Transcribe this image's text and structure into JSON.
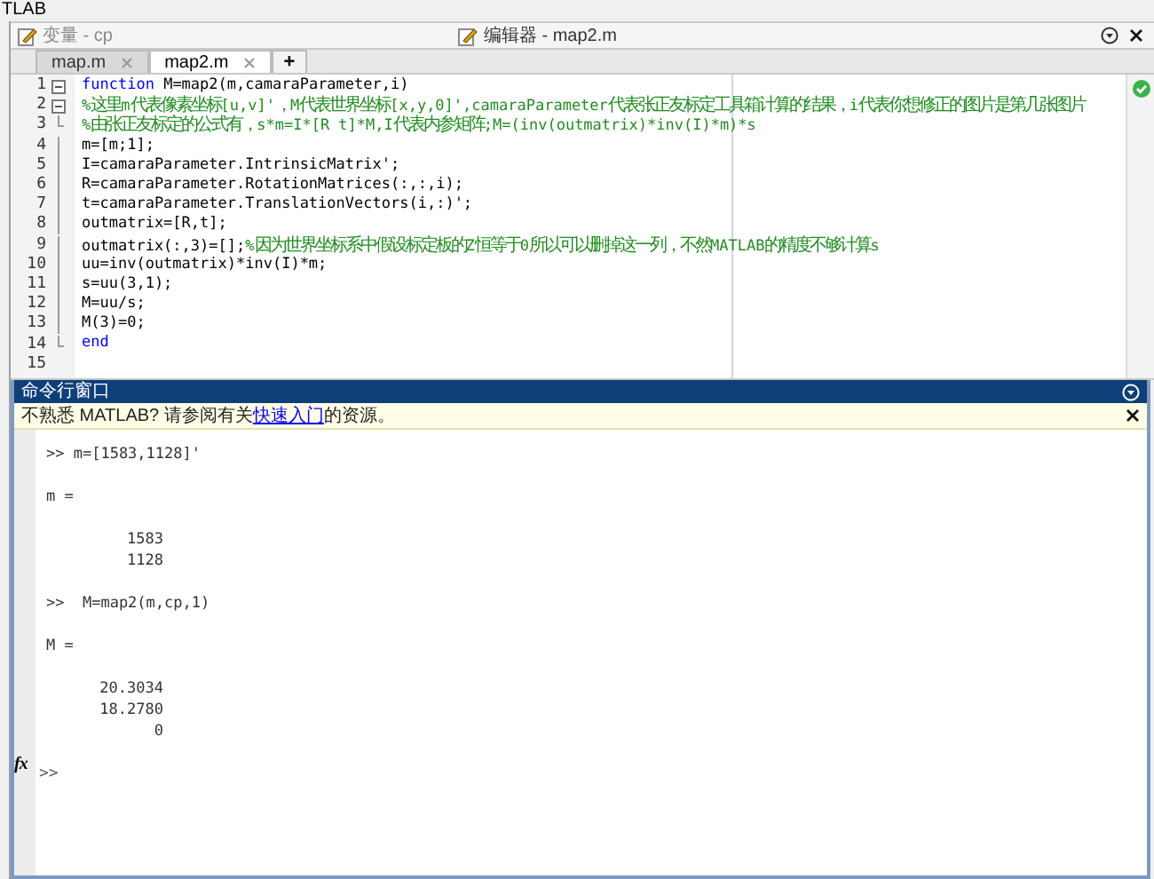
{
  "app_title": "TLAB",
  "panel_header": {
    "left_title": "变量 - cp",
    "center_title": "编辑器 - map2.m"
  },
  "tabs": [
    {
      "label": "map.m",
      "selected": false
    },
    {
      "label": "map2.m",
      "selected": true
    }
  ],
  "new_tab_label": "+",
  "editor": {
    "check_passed": true,
    "lines": [
      {
        "number": "1",
        "fold": {
          "kind": "start"
        },
        "segments": [
          {
            "kind": "keyword",
            "text": "function"
          },
          {
            "kind": "code",
            "text": " M=map2(m,camaraParameter,i)"
          }
        ]
      },
      {
        "number": "2",
        "fold": {
          "kind": "start"
        },
        "segments": [
          {
            "kind": "comment",
            "text": "%这里m代表像素坐标[u,v]'，M代表世界坐标[x,y,0]',camaraParameter代表张正友标定工具箱计算的结果，i代表你想修正的图片是第几张图片"
          }
        ]
      },
      {
        "number": "3",
        "fold": {
          "kind": "end"
        },
        "segments": [
          {
            "kind": "comment",
            "text": "%由张正友标定的公式有，s*m=I*[R t]*M,I代表内参矩阵;M=(inv(outmatrix)*inv(I)*m)*s"
          }
        ]
      },
      {
        "number": "4",
        "fold": {
          "kind": "line"
        },
        "segments": [
          {
            "kind": "code",
            "text": "m=[m;1];"
          }
        ]
      },
      {
        "number": "5",
        "fold": {
          "kind": "line"
        },
        "segments": [
          {
            "kind": "code",
            "text": "I=camaraParameter.IntrinsicMatrix';"
          }
        ]
      },
      {
        "number": "6",
        "fold": {
          "kind": "line"
        },
        "segments": [
          {
            "kind": "code",
            "text": "R=camaraParameter.RotationMatrices(:,:,i);"
          }
        ]
      },
      {
        "number": "7",
        "fold": {
          "kind": "line"
        },
        "segments": [
          {
            "kind": "code",
            "text": "t=camaraParameter.TranslationVectors(i,:)';"
          }
        ]
      },
      {
        "number": "8",
        "fold": {
          "kind": "line"
        },
        "segments": [
          {
            "kind": "code",
            "text": "outmatrix=[R,t];"
          }
        ]
      },
      {
        "number": "9",
        "fold": {
          "kind": "line"
        },
        "segments": [
          {
            "kind": "code",
            "text": "outmatrix(:,3)=[];"
          },
          {
            "kind": "comment",
            "text": "%因为世界坐标系中假设标定板的Z恒等于0所以可以删掉这一列，不然MATLAB的精度不够计算s"
          }
        ]
      },
      {
        "number": "10",
        "fold": {
          "kind": "line"
        },
        "segments": [
          {
            "kind": "code",
            "text": "uu=inv(outmatrix)*inv(I)*m;"
          }
        ]
      },
      {
        "number": "11",
        "fold": {
          "kind": "line"
        },
        "segments": [
          {
            "kind": "code",
            "text": "s=uu(3,1);"
          }
        ]
      },
      {
        "number": "12",
        "fold": {
          "kind": "line"
        },
        "segments": [
          {
            "kind": "code",
            "text": "M=uu/s;"
          }
        ]
      },
      {
        "number": "13",
        "fold": {
          "kind": "line"
        },
        "segments": [
          {
            "kind": "code",
            "text": "M(3)=0;"
          }
        ]
      },
      {
        "number": "14",
        "fold": {
          "kind": "end"
        },
        "segments": [
          {
            "kind": "keyword",
            "text": "end"
          }
        ]
      },
      {
        "number": "15"
      }
    ]
  },
  "command_window": {
    "title": "命令行窗口",
    "notice": {
      "before": "不熟悉 MATLAB? 请参阅有关",
      "link": "快速入门",
      "after": "的资源。"
    },
    "entries": [
      {
        "kind": "command",
        "text": ">> m=[1583,1128]'"
      },
      {
        "kind": "label",
        "text": "m ="
      },
      {
        "kind": "values",
        "values": [
          "1583",
          "1128"
        ]
      },
      {
        "kind": "command",
        "text": ">>  M=map2(m,cp,1)"
      },
      {
        "kind": "label",
        "text": "M ="
      },
      {
        "kind": "values",
        "values": [
          "20.3034",
          "18.2780",
          "0"
        ]
      }
    ],
    "fx_label": "fx",
    "prompt": ">>"
  }
}
